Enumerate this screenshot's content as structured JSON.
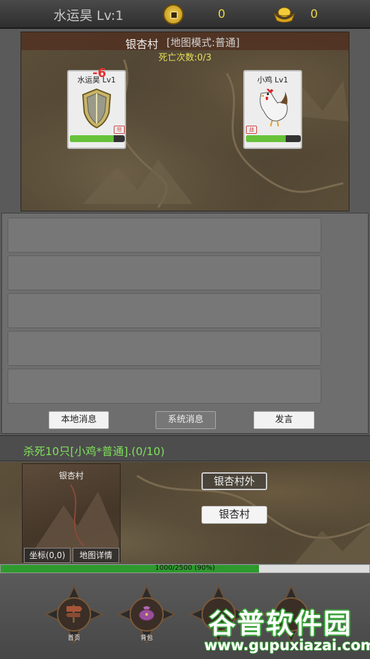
{
  "header": {
    "player_name": "水运昊 Lv:1",
    "copper_coins": "0",
    "gold_ingots": "0",
    "coin_icon": "copper-coin-icon",
    "ingot_icon": "gold-ingot-icon"
  },
  "battle": {
    "map_name": "银杏村",
    "map_mode": "[地图模式:普通]",
    "death_count": "死亡次数:0/3",
    "damage_popup": "-6",
    "player_card": {
      "name": "水运昊 Lv1",
      "hp_fraction": 0.8,
      "tag": "坦",
      "icon": "shield-icon"
    },
    "enemy_card": {
      "name": "小鸡 Lv1",
      "hp_fraction": 0.72,
      "tag": "战",
      "icon": "chicken-icon"
    },
    "hp_color": "#67c23a"
  },
  "chat": {
    "rows": [
      "",
      "",
      "",
      "",
      ""
    ],
    "tabs": {
      "local": "本地消息",
      "system": "系统消息",
      "speak": "发言"
    }
  },
  "quest": {
    "text": "杀死10只[小鸡*普通].(0/10)",
    "color": "#7fe15a"
  },
  "area": {
    "minimap_name": "银杏村",
    "coords_button": "坐标(0,0)",
    "details_button": "地图详情",
    "locations": [
      "银杏村外",
      "银杏村"
    ]
  },
  "exp": {
    "text": "1000/2500 (90%)",
    "fraction": 0.7,
    "color": "#2e9a2e"
  },
  "nav": {
    "items": [
      {
        "label": "首页",
        "icon": "signpost-icon"
      },
      {
        "label": "背包",
        "icon": "bag-icon"
      },
      {
        "label": "",
        "icon": "nav-icon-3"
      },
      {
        "label": "",
        "icon": "nav-icon-4"
      }
    ]
  },
  "watermark": {
    "title": "谷普软件园",
    "url": "www.gupuxiazai.com"
  }
}
